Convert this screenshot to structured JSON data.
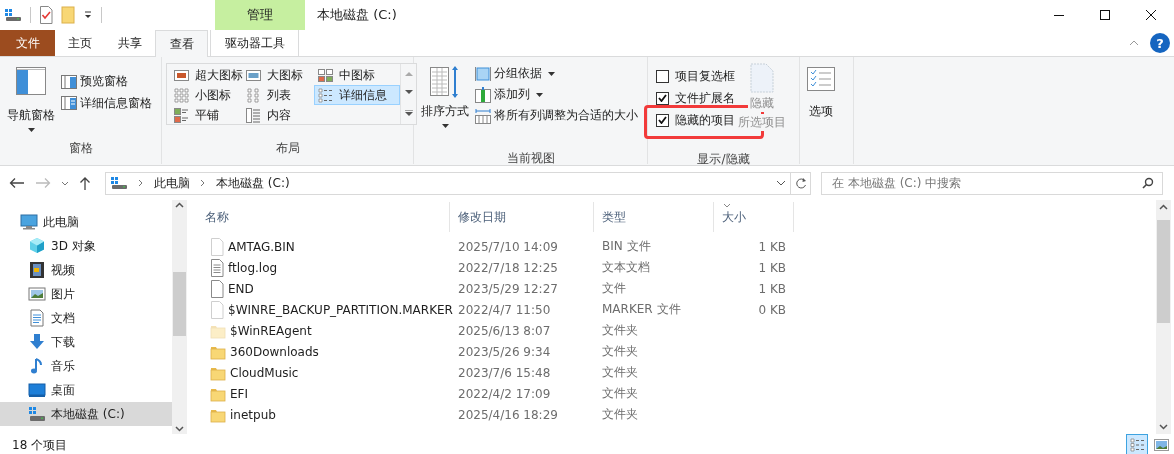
{
  "window": {
    "title": "本地磁盘 (C:)",
    "context_tab": "管理",
    "help_glyph": "?"
  },
  "ribbon_tabs": [
    {
      "label": "文件",
      "kind": "file",
      "selected": false
    },
    {
      "label": "主页",
      "kind": "plain",
      "selected": false
    },
    {
      "label": "共享",
      "kind": "plain",
      "selected": false
    },
    {
      "label": "查看",
      "kind": "plain",
      "selected": true
    },
    {
      "label": "驱动器工具",
      "kind": "context",
      "selected": false
    }
  ],
  "panes": {
    "label": "窗格",
    "nav_pane": "导航窗格",
    "preview_pane": "预览窗格",
    "details_pane": "详细信息窗格"
  },
  "layout": {
    "label": "布局",
    "options": [
      {
        "label": "超大图标",
        "kind": "xl",
        "selected": false
      },
      {
        "label": "大图标",
        "kind": "large",
        "selected": false
      },
      {
        "label": "中图标",
        "kind": "medium",
        "selected": false
      },
      {
        "label": "小图标",
        "kind": "small",
        "selected": false
      },
      {
        "label": "列表",
        "kind": "list",
        "selected": false
      },
      {
        "label": "详细信息",
        "kind": "details",
        "selected": true
      },
      {
        "label": "平铺",
        "kind": "tiles",
        "selected": false
      },
      {
        "label": "内容",
        "kind": "content",
        "selected": false
      }
    ]
  },
  "current_view": {
    "label": "当前视图",
    "sort_by": "排序方式",
    "group_by": "分组依据",
    "add_columns": "添加列",
    "size_all_columns": "将所有列调整为合适的大小"
  },
  "show_hide": {
    "label": "显示/隐藏",
    "checkboxes": [
      {
        "label": "项目复选框",
        "checked": false,
        "highlighted": false
      },
      {
        "label": "文件扩展名",
        "checked": true,
        "highlighted": false
      },
      {
        "label": "隐藏的项目",
        "checked": true,
        "highlighted": true
      }
    ],
    "hide_selected": {
      "label": "隐藏",
      "sublabel": "所选项目",
      "disabled": true
    }
  },
  "options": {
    "label": "选项"
  },
  "address": {
    "path": [
      "此电脑",
      "本地磁盘 (C:)"
    ]
  },
  "search": {
    "placeholder": "在 本地磁盘 (C:) 中搜索"
  },
  "nav": [
    {
      "label": "此电脑",
      "kind": "computer",
      "selected": false,
      "children": [
        {
          "label": "3D 对象",
          "kind": "cube",
          "selected": false
        },
        {
          "label": "视频",
          "kind": "video",
          "selected": false
        },
        {
          "label": "图片",
          "kind": "pictures",
          "selected": false
        },
        {
          "label": "文档",
          "kind": "documents",
          "selected": false
        },
        {
          "label": "下载",
          "kind": "downloads",
          "selected": false
        },
        {
          "label": "音乐",
          "kind": "music",
          "selected": false
        },
        {
          "label": "桌面",
          "kind": "desktop",
          "selected": false
        },
        {
          "label": "本地磁盘 (C:)",
          "kind": "drive",
          "selected": true
        }
      ]
    }
  ],
  "columns": [
    {
      "label": "名称",
      "sorted": false
    },
    {
      "label": "修改日期",
      "sorted": false
    },
    {
      "label": "类型",
      "sorted": false
    },
    {
      "label": "大小",
      "sorted": true
    }
  ],
  "files": [
    {
      "name": "AMTAG.BIN",
      "modified": "2025/7/10 14:09",
      "type": "BIN 文件",
      "size": "1 KB",
      "kind": "file",
      "hidden": true
    },
    {
      "name": "ftlog.log",
      "modified": "2022/7/18 12:25",
      "type": "文本文档",
      "size": "1 KB",
      "kind": "text",
      "hidden": false
    },
    {
      "name": "END",
      "modified": "2023/5/29 12:27",
      "type": "文件",
      "size": "1 KB",
      "kind": "file",
      "hidden": false
    },
    {
      "name": "$WINRE_BACKUP_PARTITION.MARKER",
      "modified": "2022/4/7 11:50",
      "type": "MARKER 文件",
      "size": "0 KB",
      "kind": "file",
      "hidden": true
    },
    {
      "name": "$WinREAgent",
      "modified": "2025/6/13 8:07",
      "type": "文件夹",
      "kind": "folder",
      "hidden": true
    },
    {
      "name": "360Downloads",
      "modified": "2023/5/26 9:34",
      "type": "文件夹",
      "kind": "folder",
      "hidden": false
    },
    {
      "name": "CloudMusic",
      "modified": "2023/7/6 15:48",
      "type": "文件夹",
      "kind": "folder",
      "hidden": false
    },
    {
      "name": "EFI",
      "modified": "2022/4/2 17:09",
      "type": "文件夹",
      "kind": "folder",
      "hidden": false
    },
    {
      "name": "inetpub",
      "modified": "2025/4/16 18:29",
      "type": "文件夹",
      "kind": "folder",
      "hidden": false
    }
  ],
  "status_bar": {
    "item_count": "18 个项目",
    "views": [
      {
        "kind": "details",
        "selected": true
      },
      {
        "kind": "large",
        "selected": false
      }
    ]
  }
}
